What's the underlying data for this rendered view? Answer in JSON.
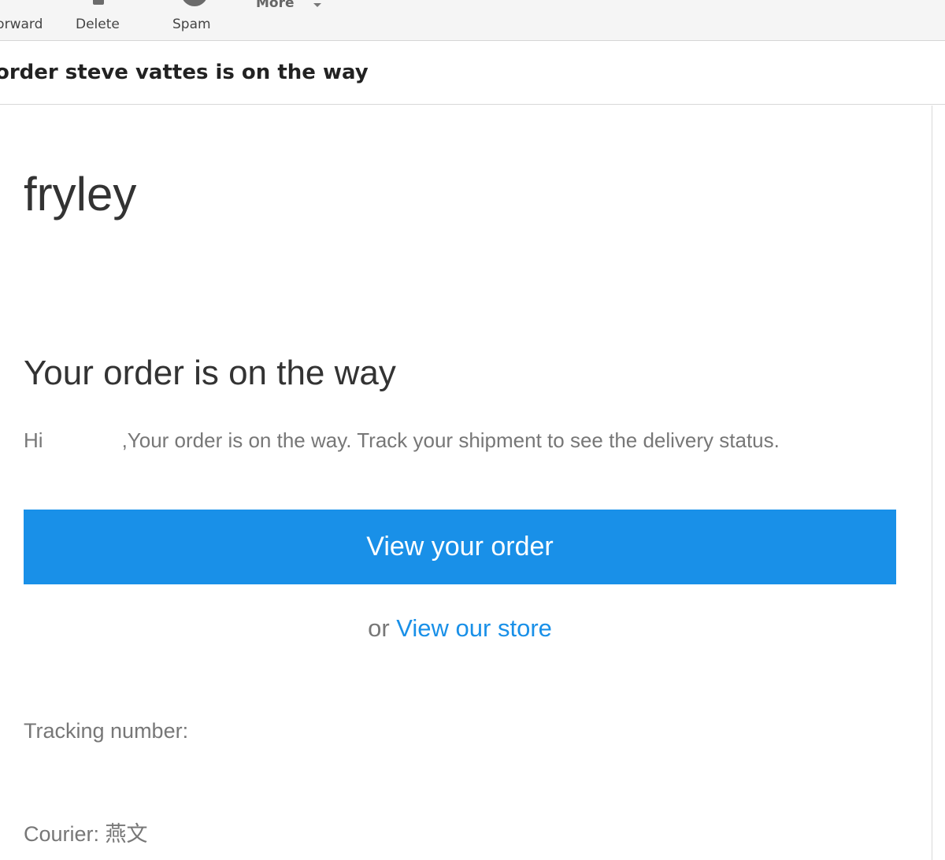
{
  "toolbar": {
    "forward_label": "Forward",
    "delete_label": "Delete",
    "spam_label": "Spam",
    "more_label": "More"
  },
  "email": {
    "subject": "order steve vattes is on the way",
    "brand": "fryley",
    "heading": "Your order is on the way",
    "greeting_hi": "Hi",
    "greeting_body": ",Your order is on the way. Track your shipment to see the delivery status.",
    "cta_label": "View your order",
    "alt_prefix": "or",
    "alt_link": "View our store",
    "tracking_label": "Tracking number:",
    "courier_label": "Courier: 燕文"
  },
  "colors": {
    "accent": "#1990e8",
    "text_dark": "#333333",
    "text_muted": "#777777"
  },
  "icons": {
    "delete": "trash-icon",
    "spam": "spam-icon",
    "more": "chevron-down-icon"
  }
}
